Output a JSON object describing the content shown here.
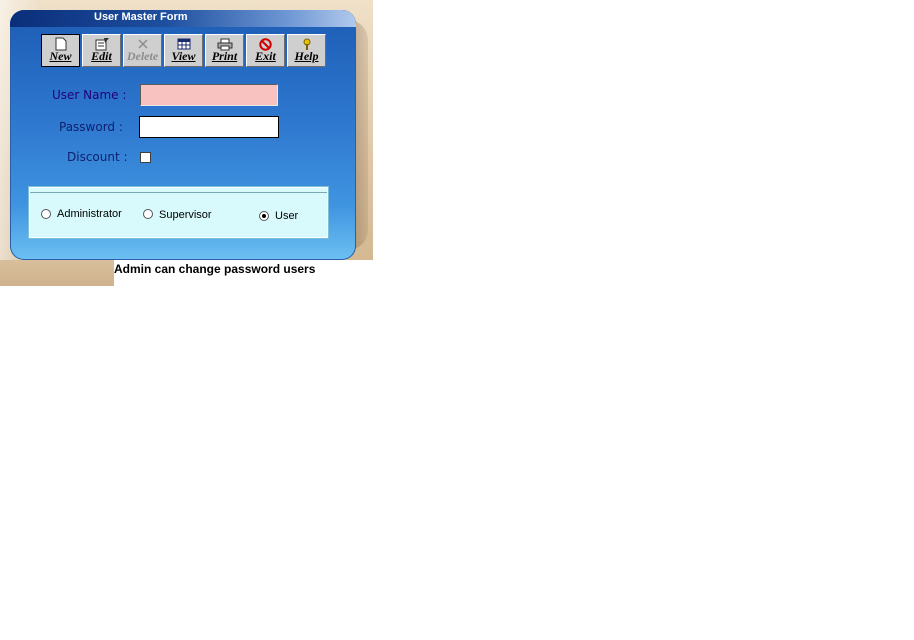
{
  "window": {
    "title": "User Master Form"
  },
  "toolbar": {
    "buttons": [
      {
        "label": "New",
        "icon": "new-document-icon",
        "state": "pressed"
      },
      {
        "label": "Edit",
        "icon": "edit-document-icon",
        "state": "enabled"
      },
      {
        "label": "Delete",
        "icon": "delete-x-icon",
        "state": "disabled"
      },
      {
        "label": "View",
        "icon": "view-table-icon",
        "state": "enabled"
      },
      {
        "label": "Print",
        "icon": "printer-icon",
        "state": "enabled"
      },
      {
        "label": "Exit",
        "icon": "exit-no-icon",
        "state": "enabled"
      },
      {
        "label": "Help",
        "icon": "help-key-icon",
        "state": "enabled"
      }
    ]
  },
  "form": {
    "username_label": "User Name :",
    "username_value": "",
    "password_label": "Password :",
    "password_value": "",
    "discount_label": "Discount :",
    "discount_checked": false
  },
  "roles": {
    "options": [
      "Administrator",
      "Supervisor",
      "User"
    ],
    "selected": "User"
  },
  "caption": "Admin can change password users",
  "colors": {
    "window_blue": "#2e78cf",
    "username_bg": "#f8c2c0",
    "role_panel_bg": "#d8fafc",
    "label_color": "#21007e"
  }
}
